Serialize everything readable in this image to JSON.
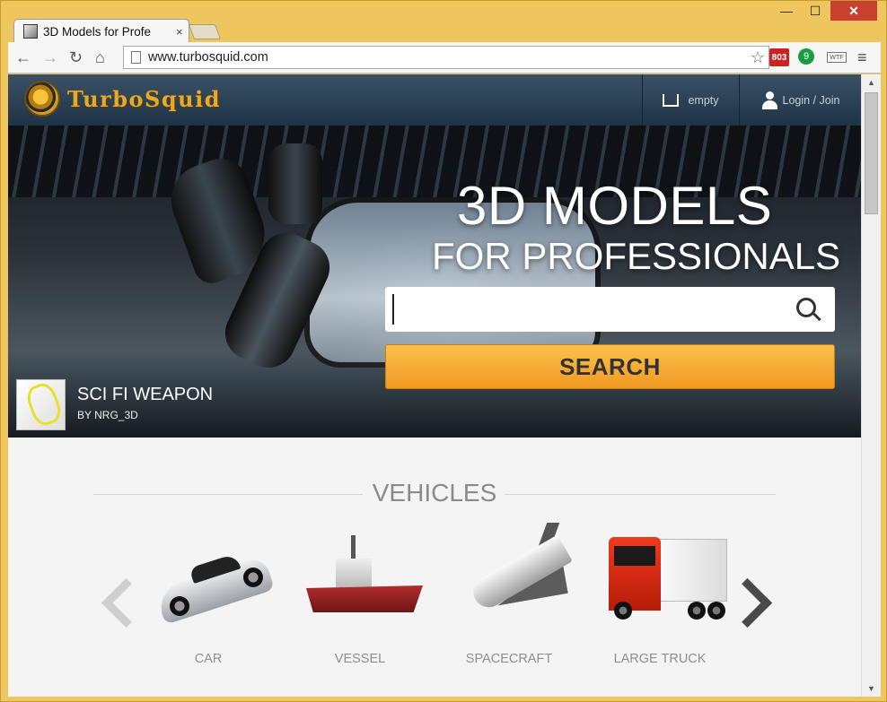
{
  "browser": {
    "tab_title": "3D Models for Profe",
    "tab_close": "×",
    "url": "www.turbosquid.com",
    "window_controls": {
      "minimize": "—",
      "maximize": "☐",
      "close": "✕"
    },
    "extensions": {
      "gmail_count": "803",
      "hangouts": "9",
      "wtf": "WTF"
    },
    "icons": [
      "back-icon",
      "forward-icon",
      "reload-icon",
      "home-icon",
      "star-icon",
      "menu-icon"
    ]
  },
  "header": {
    "logo_text": "TurboSquid",
    "cart_label": "empty",
    "login_label": "Login / Join"
  },
  "hero": {
    "title_line1": "3D MODELS",
    "title_line2": "FOR PROFESSIONALS",
    "search_placeholder": "",
    "search_button": "SEARCH",
    "featured_title": "SCI FI WEAPON",
    "featured_by": "BY NRG_3D"
  },
  "vehicles": {
    "title": "VEHICLES",
    "items": [
      {
        "label": "CAR"
      },
      {
        "label": "VESSEL"
      },
      {
        "label": "SPACECRAFT"
      },
      {
        "label": "LARGE TRUCK"
      }
    ]
  },
  "colors": {
    "window_frame": "#efc55e",
    "header_bg": "#2b4156",
    "search_button": "#f4a631",
    "logo": "#e8a924"
  }
}
